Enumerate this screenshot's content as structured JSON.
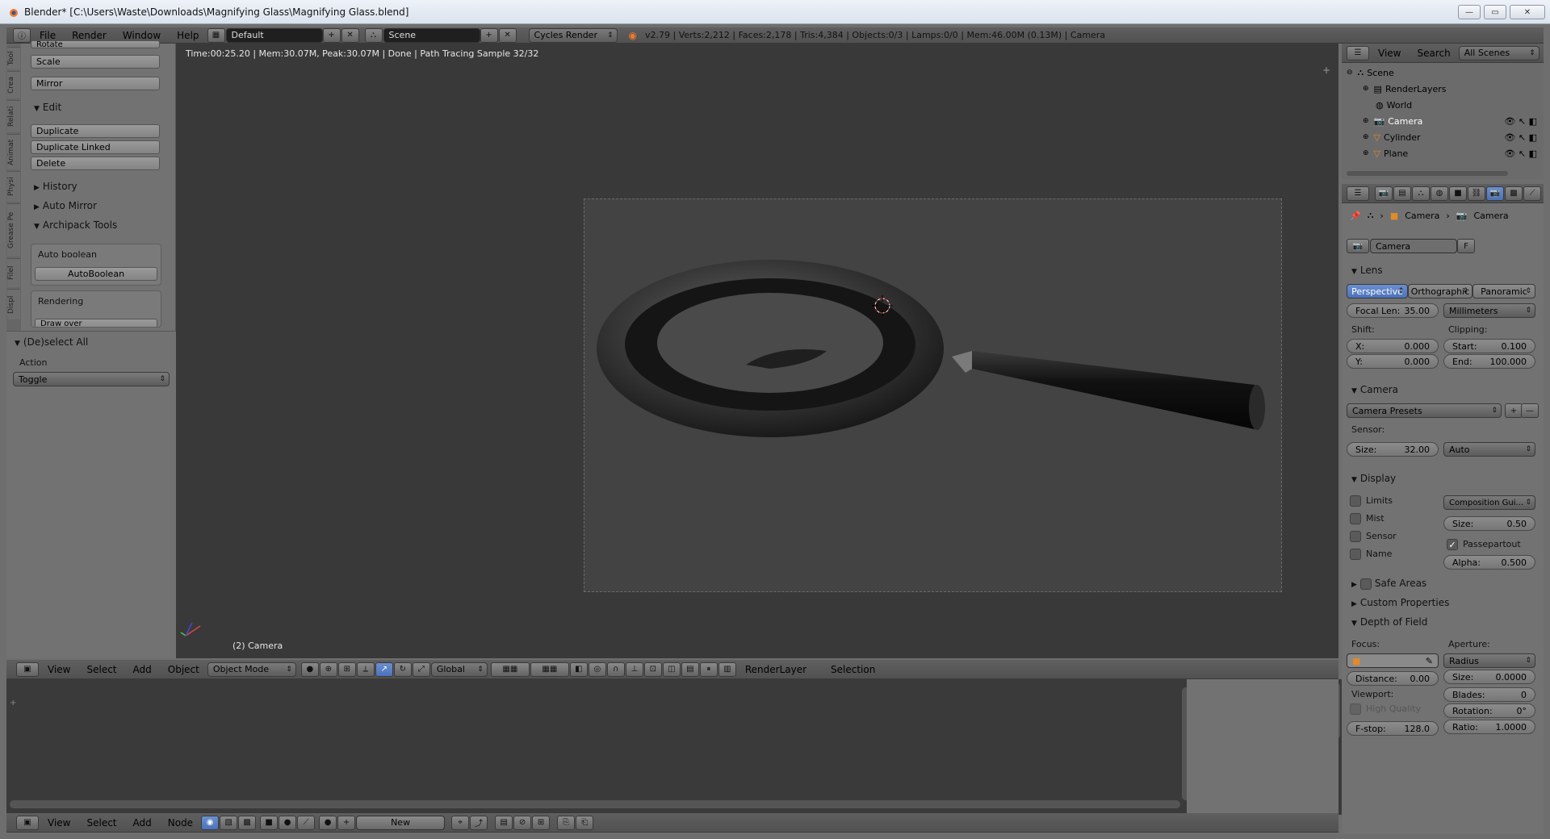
{
  "window": {
    "title": "Blender* [C:\\Users\\Waste\\Downloads\\Magnifying Glass\\Magnifying Glass.blend]"
  },
  "top_menu": {
    "items": [
      "File",
      "Render",
      "Window",
      "Help"
    ],
    "layout": "Default",
    "scene": "Scene",
    "engine": "Cycles Render",
    "stats": "v2.79 | Verts:2,212 | Faces:2,178 | Tris:4,384 | Objects:0/3 | Lamps:0/0 | Mem:46.00M (0.13M) | Camera"
  },
  "toolshelf": {
    "tabs": [
      "Tool",
      "Crea",
      "Relati",
      "Animat",
      "Physi",
      "Grease Pe",
      "Filel",
      "Displ"
    ],
    "rotate": "Rotate",
    "scale": "Scale",
    "mirror": "Mirror",
    "edit_header": "Edit",
    "duplicate": "Duplicate",
    "duplicate_linked": "Duplicate Linked",
    "delete": "Delete",
    "history": "History",
    "auto_mirror": "Auto Mirror",
    "archipack": "Archipack Tools",
    "auto_boolean_label": "Auto boolean",
    "auto_boolean_btn": "AutoBoolean",
    "rendering": "Rendering",
    "draw_over": "Draw over",
    "operator_header": "(De)select All",
    "action_label": "Action",
    "action_value": "Toggle"
  },
  "viewport": {
    "render_info": "Time:00:25.20 | Mem:30.07M, Peak:30.07M | Done | Path Tracing Sample 32/32",
    "object_label": "(2) Camera"
  },
  "view3d_header": {
    "items": [
      "View",
      "Select",
      "Add",
      "Object"
    ],
    "mode": "Object Mode",
    "orientation": "Global",
    "render_layer": "RenderLayer",
    "selection": "Selection"
  },
  "node_header": {
    "items": [
      "View",
      "Select",
      "Add",
      "Node"
    ],
    "new": "New"
  },
  "outliner": {
    "header": {
      "view": "View",
      "search": "Search",
      "filter": "All Scenes"
    },
    "rows": [
      "Scene",
      "RenderLayers",
      "World",
      "Camera",
      "Cylinder",
      "Plane"
    ]
  },
  "properties": {
    "breadcrumb": [
      "Camera",
      "Camera"
    ],
    "datablock": "Camera",
    "fake_user": "F",
    "lens": {
      "header": "Lens",
      "types": [
        "Perspective",
        "Orthographic",
        "Panoramic"
      ],
      "focal_label": "Focal Len:",
      "focal_value": "35.00",
      "unit": "Millimeters",
      "shift_label": "Shift:",
      "clipping_label": "Clipping:",
      "shift_x_label": "X:",
      "shift_x": "0.000",
      "shift_y_label": "Y:",
      "shift_y": "0.000",
      "clip_start_label": "Start:",
      "clip_start": "0.100",
      "clip_end_label": "End:",
      "clip_end": "100.000"
    },
    "camera": {
      "header": "Camera",
      "presets": "Camera Presets",
      "sensor_label": "Sensor:",
      "size_label": "Size:",
      "size_value": "32.00",
      "fit": "Auto"
    },
    "display": {
      "header": "Display",
      "limits": "Limits",
      "mist": "Mist",
      "sensor": "Sensor",
      "name": "Name",
      "guides": "Composition Gui...",
      "size_label": "Size:",
      "size_value": "0.50",
      "passepartout": "Passepartout",
      "alpha_label": "Alpha:",
      "alpha_value": "0.500"
    },
    "safe_areas": "Safe Areas",
    "custom_props": "Custom Properties",
    "dof": {
      "header": "Depth of Field",
      "focus_label": "Focus:",
      "aperture_label": "Aperture:",
      "aperture_type": "Radius",
      "distance_label": "Distance:",
      "distance_value": "0.00",
      "size_label": "Size:",
      "size_value": "0.0000",
      "viewport_label": "Viewport:",
      "blades_label": "Blades:",
      "blades_value": "0",
      "high_quality": "High Quality",
      "rotation_label": "Rotation:",
      "rotation_value": "0°",
      "fstop_label": "F-stop:",
      "fstop_value": "128.0",
      "ratio_label": "Ratio:",
      "ratio_value": "1.0000"
    }
  }
}
